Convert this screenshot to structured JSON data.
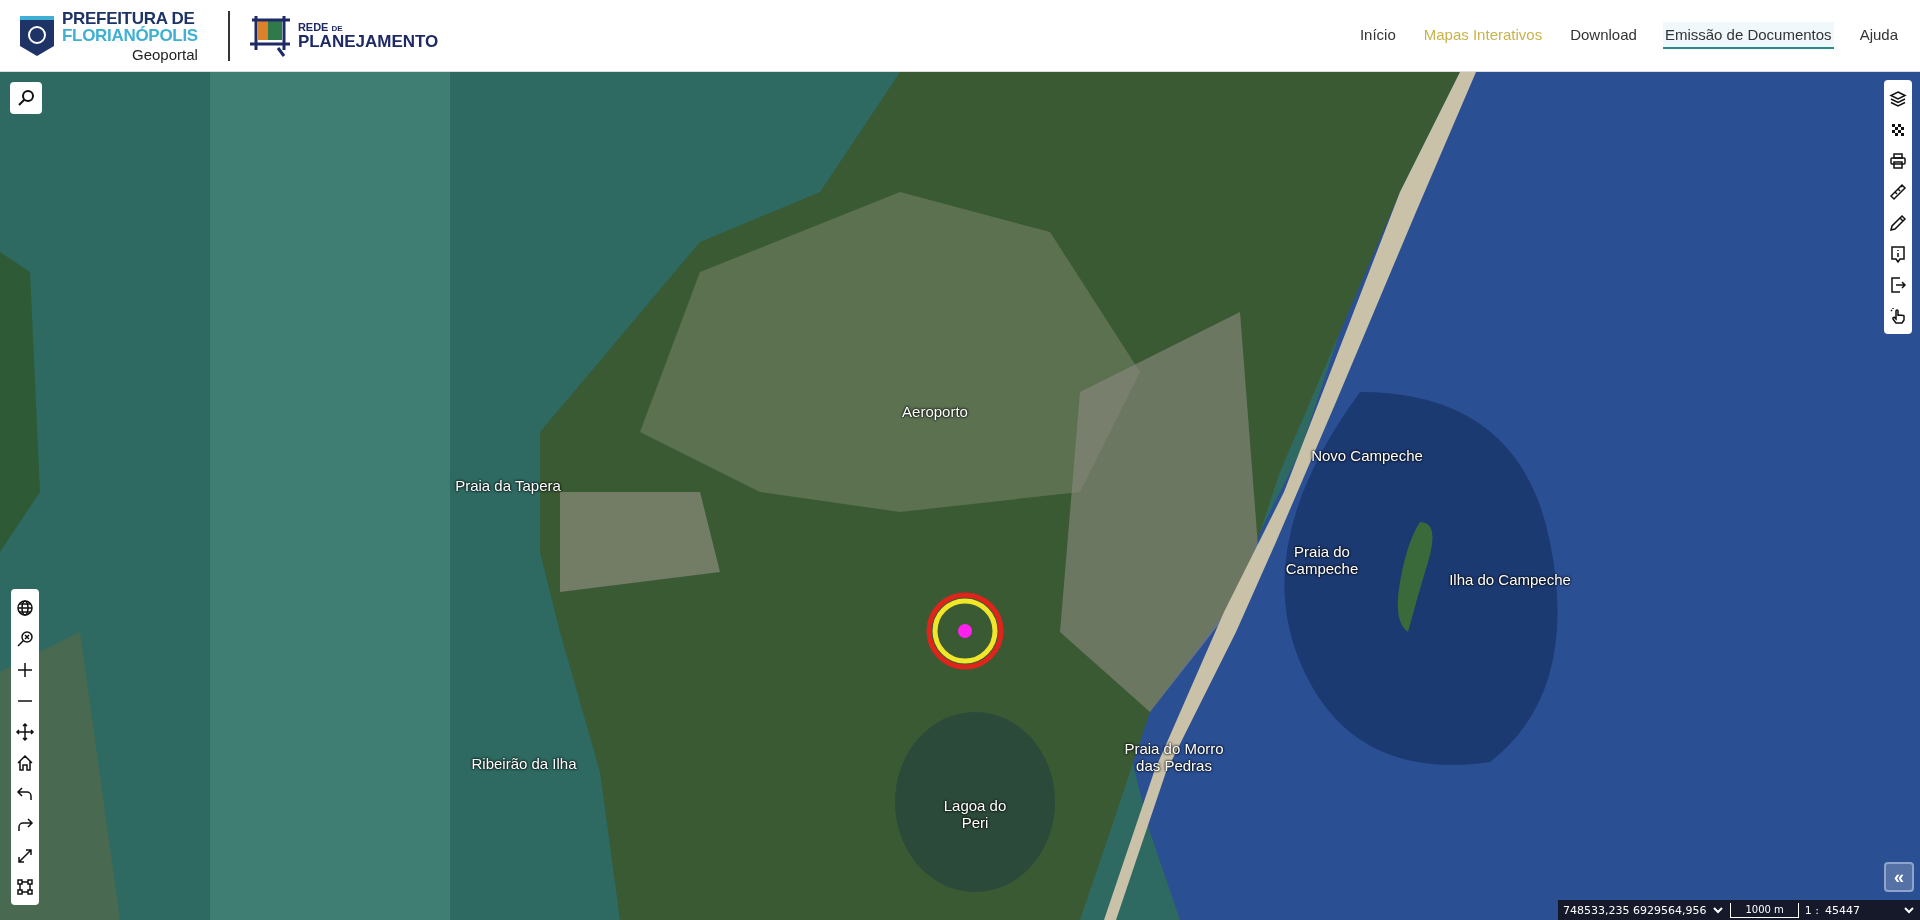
{
  "header": {
    "logo": {
      "line_1": "PREFEITURA DE",
      "line_2": "FLORIANÓPOLIS",
      "subtitle": "Geoportal"
    },
    "partner_logo": {
      "line_1": "REDE",
      "line_1_small": "DE",
      "line_2": "PLANEJAMENTO"
    },
    "nav": [
      {
        "label": "Início",
        "selected": false,
        "hovered": false
      },
      {
        "label": "Mapas Interativos",
        "selected": false,
        "hovered": true
      },
      {
        "label": "Download",
        "selected": false,
        "hovered": false
      },
      {
        "label": "Emissão de Documentos",
        "selected": true,
        "hovered": false
      },
      {
        "label": "Ajuda",
        "selected": false,
        "hovered": false
      }
    ]
  },
  "map": {
    "labels": [
      "Aeroporto",
      "Praia da Tapera",
      "Novo Campeche",
      "Praia do Campeche",
      "Ilha do Campeche",
      "Ribeirão da Ilha",
      "Praia do Morro das Pedras",
      "Lagoa do Peri"
    ],
    "collapse_button": "«",
    "status_bar": {
      "coordinates": "748533,235 6929564,956",
      "scale_bar": "1000 m",
      "scale_prefix": "1 :",
      "scale": "45447"
    }
  }
}
